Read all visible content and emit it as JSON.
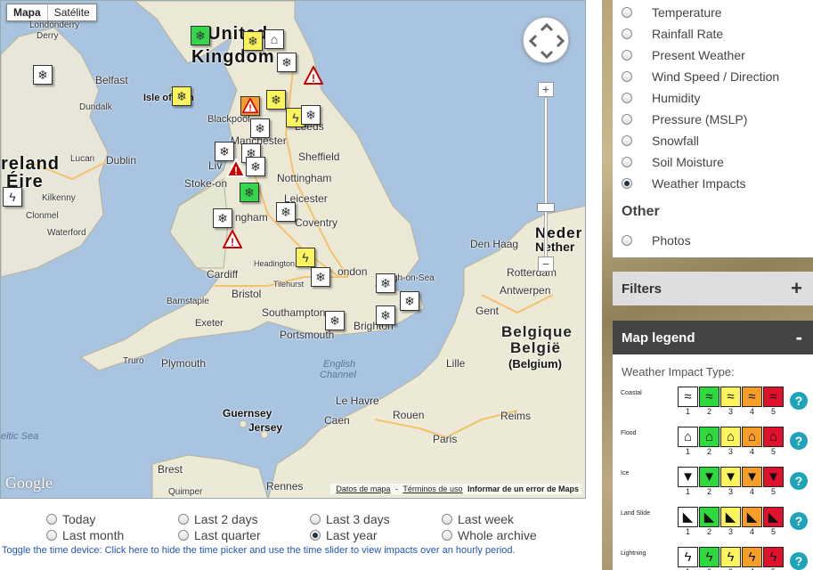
{
  "map": {
    "type_controls": [
      "Mapa",
      "Satélite"
    ],
    "labels": {
      "united": "United",
      "kingdom": "Kingdom",
      "ireland": "reland",
      "eire": "Éire",
      "londonderry": "Londonderry",
      "derry": "Derry",
      "belfast": "Belfast",
      "dundalk": "Dundalk",
      "isle_of_man": "Isle of Man",
      "blackpool": "Blackpool",
      "leeds": "Leeds",
      "manchester": "Manchester",
      "sheffield": "Sheffield",
      "liverpool": "Liv",
      "stoke": "Stoke-on",
      "nottingham": "Nottingham",
      "leicester": "Leicester",
      "birmingham": "ngham",
      "coventry": "Coventry",
      "lucan": "Lucan",
      "dublin": "Dublin",
      "kilkenny": "Kilkenny",
      "clonmel": "Clonmel",
      "waterford": "Waterford",
      "cardiff": "Cardiff",
      "bristol": "Bristol",
      "barnstaple": "Barnstaple",
      "exeter": "Exeter",
      "truro": "Truro",
      "plymouth": "Plymouth",
      "headington": "Headington",
      "tilehurst": "Tilehurst",
      "london": "ondon",
      "southend": "gh-on-Sea",
      "southampton": "Southampton",
      "portsmouth": "Portsmouth",
      "brighton": "Brighton",
      "english_channel_1": "English",
      "english_channel_2": "Channel",
      "celtic_sea": "eltic Sea",
      "guernsey": "Guernsey",
      "jersey": "Jersey",
      "den_haag": "Den Haag",
      "neder": "Neder",
      "nether": "Nether",
      "rotterdam": "Rotterdam",
      "antwerpen": "Antwerpen",
      "gent": "Gent",
      "belgique": "Belgique",
      "belgie": "België",
      "belgium": "(Belgium)",
      "lille": "Lille",
      "le_havre": "Le Havre",
      "rouen": "Rouen",
      "reims": "Reims",
      "caen": "Caen",
      "paris": "Paris",
      "rennes": "Rennes",
      "brest": "Brest",
      "quimper": "Quimper",
      "dundalk2": "Dundalk"
    },
    "footer": {
      "map_data": "Datos de mapa",
      "terms": "Términos de uso",
      "report": "Informar de un error de Maps"
    },
    "logo": "Google",
    "zoom_in": "+",
    "zoom_out": "−"
  },
  "time_options": {
    "row1": [
      {
        "label": "Today",
        "selected": false
      },
      {
        "label": "Last 2 days",
        "selected": false
      },
      {
        "label": "Last 3 days",
        "selected": false
      },
      {
        "label": "Last week",
        "selected": false
      }
    ],
    "row2": [
      {
        "label": "Last month",
        "selected": false
      },
      {
        "label": "Last quarter",
        "selected": false
      },
      {
        "label": "Last year",
        "selected": true
      },
      {
        "label": "Whole archive",
        "selected": false
      }
    ],
    "toggle_text": "Toggle the time device: Click here to hide the time picker and use the time slider to view impacts over an hourly period."
  },
  "layers": {
    "items": [
      {
        "label": "Temperature",
        "selected": false
      },
      {
        "label": "Rainfall Rate",
        "selected": false
      },
      {
        "label": "Present Weather",
        "selected": false
      },
      {
        "label": "Wind Speed / Direction",
        "selected": false
      },
      {
        "label": "Humidity",
        "selected": false
      },
      {
        "label": "Pressure (MSLP)",
        "selected": false
      },
      {
        "label": "Snowfall",
        "selected": false
      },
      {
        "label": "Soil Moisture",
        "selected": false
      },
      {
        "label": "Weather Impacts",
        "selected": true
      }
    ],
    "other_heading": "Other",
    "other_items": [
      {
        "label": "Photos",
        "selected": false
      }
    ]
  },
  "filters": {
    "title": "Filters",
    "sign": "+"
  },
  "legend": {
    "title": "Map legend",
    "sign": "-",
    "subtitle": "Weather Impact Type:",
    "levels": [
      "1",
      "2",
      "3",
      "4",
      "5"
    ],
    "level_colors": [
      "#ffffff",
      "#2fd93d",
      "#fbf45f",
      "#f79d2a",
      "#e0112c"
    ],
    "help": "?",
    "types": [
      {
        "name": "Coastal",
        "icon": "wave-icon"
      },
      {
        "name": "Flood",
        "icon": "house-flood-icon"
      },
      {
        "name": "Ice",
        "icon": "icicle-icon"
      },
      {
        "name": "Land Slide",
        "icon": "landslide-icon"
      },
      {
        "name": "Lightning",
        "icon": "lightning-icon"
      }
    ]
  }
}
